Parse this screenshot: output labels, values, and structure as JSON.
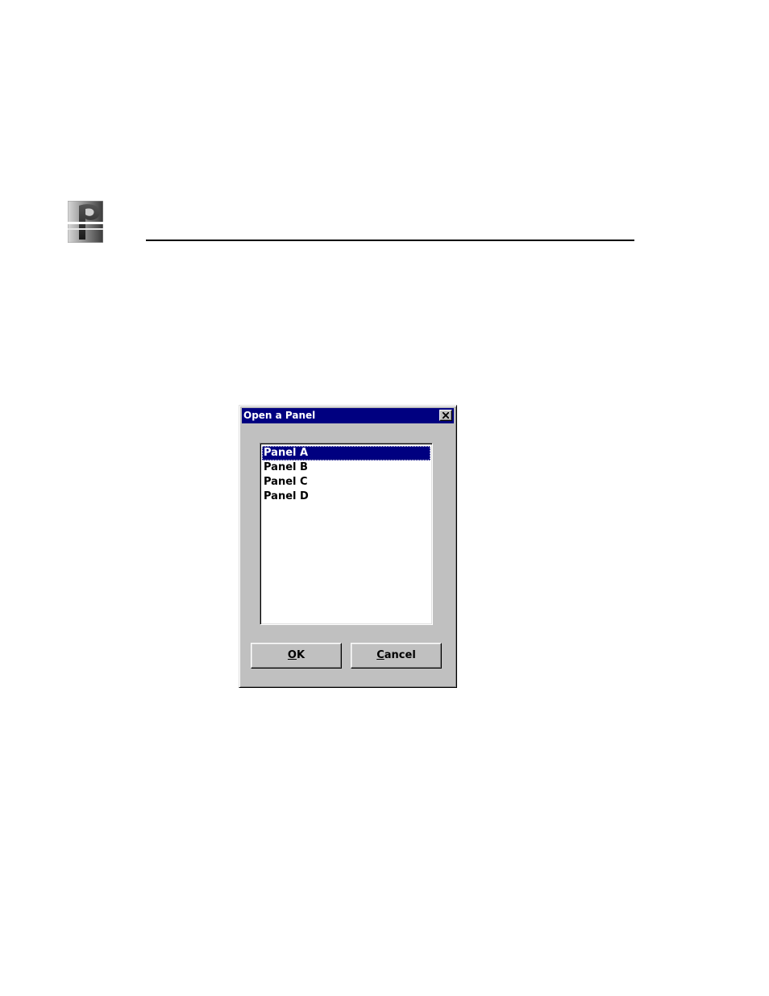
{
  "dialog": {
    "title": "Open a Panel",
    "list_items": [
      {
        "label": "Panel A",
        "selected": true
      },
      {
        "label": "Panel B",
        "selected": false
      },
      {
        "label": "Panel C",
        "selected": false
      },
      {
        "label": "Panel D",
        "selected": false
      }
    ],
    "ok_button": {
      "accel": "O",
      "rest": "K"
    },
    "cancel_button": {
      "accel": "C",
      "rest": "ancel"
    }
  },
  "icons": {
    "logo": "company-logo-icon",
    "close": "close-icon"
  },
  "colors": {
    "titlebar": "#000080",
    "dialog_face": "#c0c0c0",
    "selection": "#000080",
    "rule": "#000000"
  }
}
